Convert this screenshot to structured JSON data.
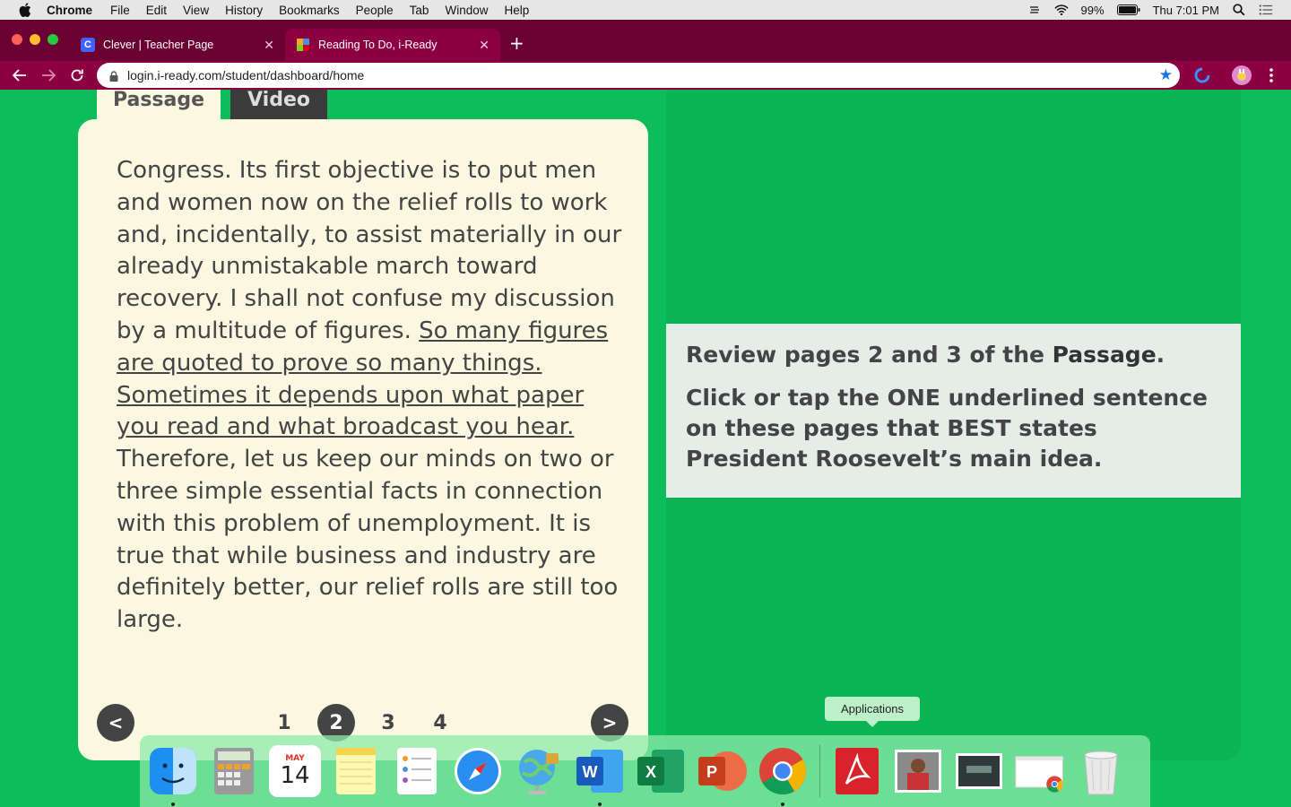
{
  "menubar": {
    "app_name": "Chrome",
    "items": [
      "File",
      "Edit",
      "View",
      "History",
      "Bookmarks",
      "People",
      "Tab",
      "Window",
      "Help"
    ],
    "battery": "99%",
    "clock": "Thu 7:01 PM"
  },
  "tabs": [
    {
      "title": "Clever | Teacher Page",
      "favicon": "C",
      "active": false
    },
    {
      "title": "Reading To Do, i-Ready",
      "favicon": "i",
      "active": true
    }
  ],
  "toolbar": {
    "url": "login.i-ready.com/student/dashboard/home"
  },
  "lesson": {
    "tab_passage": "Passage",
    "tab_video": "Video",
    "text_1": "Congress. Its first objective is to put men and women now on the relief rolls to work and, incidentally, to assist materially in our already unmistakable march toward recovery. I shall not confuse my discussion by a multitude of figures. ",
    "underlined_1": "So many figures are quoted to prove so many things.",
    "text_2": " ",
    "underlined_2": "Sometimes it depends upon what paper you read and what broadcast you hear.",
    "text_3": " Therefore, let us keep our minds on two or three simple essential facts in connection with this problem of unemployment. It is true that while business and industry are definitely better, our relief rolls are still too large.",
    "pager": {
      "prev": "<",
      "next": ">",
      "pages": [
        "1",
        "2",
        "3",
        "4"
      ],
      "current": "2"
    },
    "instruction": {
      "line1_pre": "Review pages 2 and 3 of the ",
      "line1_bold": "Passage",
      "line1_post": ".",
      "line2": "Click or tap the ONE underlined sentence on these pages that BEST states President Roosevelt’s main idea."
    }
  },
  "dock": {
    "tooltip": "Applications",
    "calendar_month": "MAY",
    "calendar_day": "14",
    "apps": [
      "finder-icon",
      "calculator-icon",
      "calendar-icon",
      "notes-icon",
      "reminders-icon",
      "safari-icon",
      "network-icon",
      "word-icon",
      "excel-icon",
      "powerpoint-icon",
      "chrome-icon",
      "acrobat-icon",
      "photo-icon",
      "screenshot-icon",
      "chrome-window-icon",
      "trash-icon"
    ]
  },
  "colors": {
    "page_bg": "#0dbd5a",
    "tabstrip": "#6b0033",
    "toolbar": "#8c0041",
    "card": "#faf8e1",
    "instruction_bg": "#e4ede8"
  }
}
